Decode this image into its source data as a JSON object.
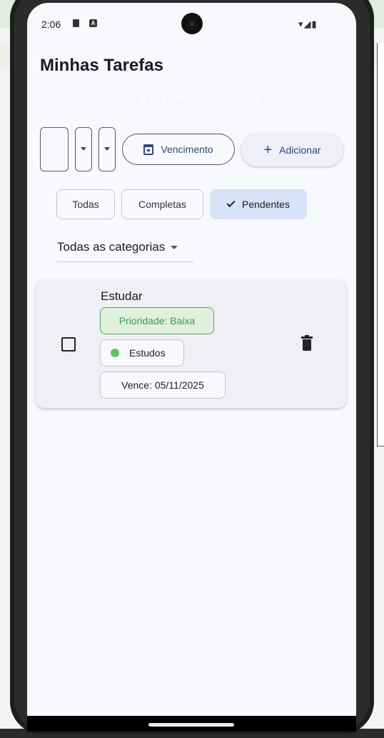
{
  "status_bar": {
    "time": "2:06",
    "icons_right": "▾◢▮"
  },
  "app": {
    "title": "Minhas Tarefas",
    "summary": "Total: 3 • Feitas: 2 • Pendentes: 1"
  },
  "controls": {
    "due_button_label": "Vencimento",
    "add_button_label": "Adicionar"
  },
  "filters": {
    "items": [
      {
        "label": "Todas",
        "selected": false
      },
      {
        "label": "Completas",
        "selected": false
      },
      {
        "label": "Pendentes",
        "selected": true
      }
    ]
  },
  "category_filter": {
    "selected": "Todas as categorias"
  },
  "tasks": [
    {
      "title": "Estudar",
      "priority": "Prioridade: Baixa",
      "category": "Estudos",
      "due": "Vence: 05/11/2025",
      "done": false,
      "category_color": "#63c26c"
    }
  ],
  "colors": {
    "accent": "#2e4a7a",
    "selected_chip": "#d9e3f7",
    "priority_low": "#3c9b4a"
  }
}
